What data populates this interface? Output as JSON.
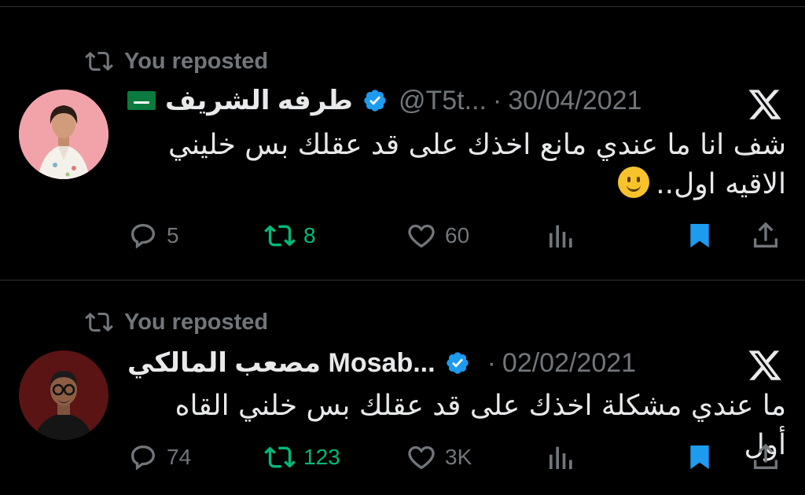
{
  "posts": [
    {
      "repost_label": "You reposted",
      "author_name": "طرفه الشريف",
      "handle": "@T5t...",
      "separator": "·",
      "date": "30/04/2021",
      "text_line1": "شف انا ما عندي مانع اخذك على قد عقلك بس خليني",
      "text_line2": "الاقيه اول..",
      "emoji": "slightly-smiling-face",
      "replies": "5",
      "reposts": "8",
      "likes": "60",
      "views": ""
    },
    {
      "repost_label": "You reposted",
      "author_name": "مصعب المالكي Mosab...",
      "handle": "",
      "separator": "·",
      "date": "02/02/2021",
      "text_line1": "ما عندي مشكلة اخذك على قد عقلك بس خلني القاه أول",
      "replies": "74",
      "reposts": "123",
      "likes": "3K",
      "views": ""
    }
  ],
  "colors": {
    "background": "#000000",
    "text": "#e7e9ea",
    "muted": "#71767b",
    "repost_green": "#00ba7c",
    "bookmark_blue": "#1d9bf0",
    "divider": "#2f3336"
  }
}
